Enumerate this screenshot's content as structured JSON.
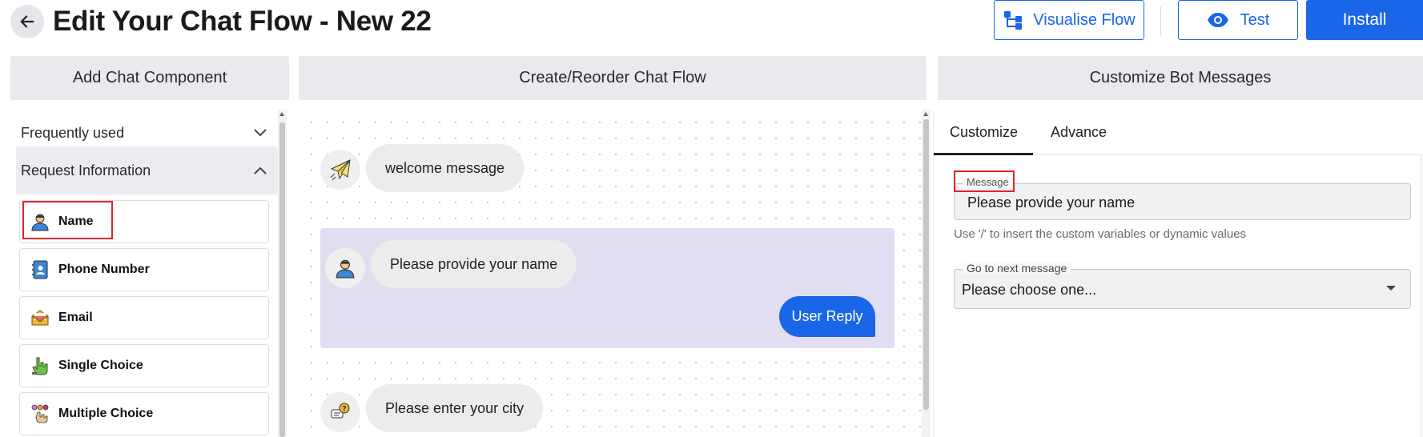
{
  "header": {
    "title": "Edit Your Chat Flow - New 22",
    "visualise_label": "Visualise Flow",
    "test_label": "Test",
    "install_label": "Install",
    "accent_color": "#1a66e8"
  },
  "columns": {
    "left": "Add Chat Component",
    "middle": "Create/Reorder Chat Flow",
    "right": "Customize Bot Messages"
  },
  "components_panel": {
    "frequently_used": "Frequently used",
    "request_information": "Request Information",
    "items": [
      {
        "label": "Name",
        "icon": "user-icon"
      },
      {
        "label": "Phone Number",
        "icon": "contact-book-icon"
      },
      {
        "label": "Email",
        "icon": "envelope-icon"
      },
      {
        "label": "Single Choice",
        "icon": "pointing-hand-icon"
      },
      {
        "label": "Multiple Choice",
        "icon": "multi-choice-icon"
      }
    ]
  },
  "flow": {
    "steps": [
      {
        "text": "welcome message",
        "icon": "paper-plane-icon"
      },
      {
        "text": "Please provide your name",
        "icon": "user-icon",
        "reply": "User Reply"
      },
      {
        "text": "Please enter your city",
        "icon": "question-chat-icon"
      }
    ],
    "selected_group_color": "#e2def2"
  },
  "customize": {
    "tabs": [
      "Customize",
      "Advance"
    ],
    "active_tab": "Customize",
    "message_label": "Message",
    "message_value": "Please provide your name",
    "helper_text": "Use '/' to insert the custom variables or dynamic values",
    "next_label": "Go to next message",
    "next_value": "Please choose one..."
  }
}
